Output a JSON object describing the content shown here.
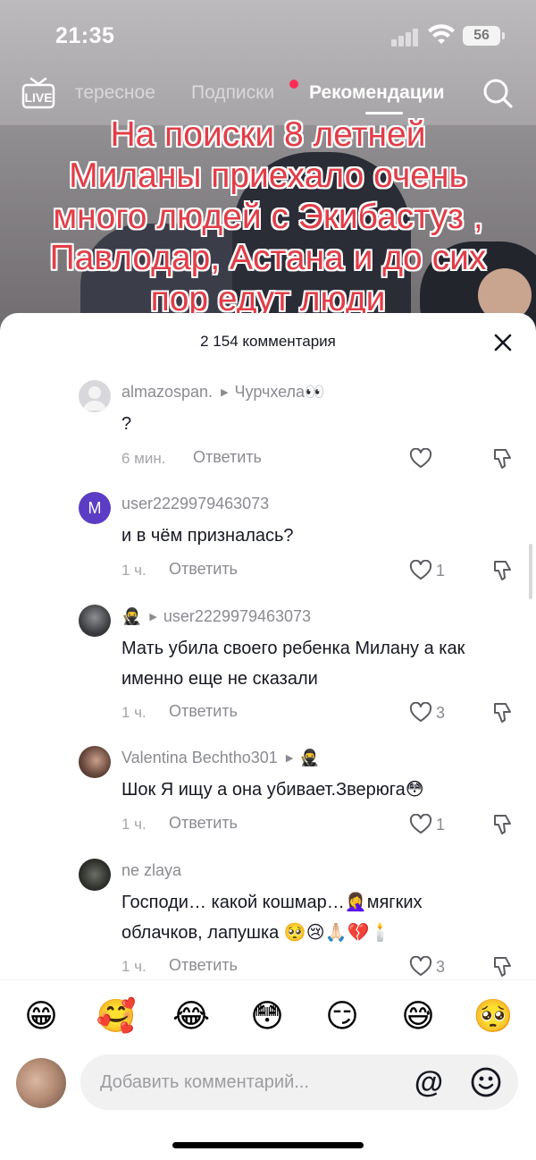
{
  "status_bar": {
    "time": "21:35",
    "battery": "56"
  },
  "top_nav": {
    "live_label": "LIVE",
    "tabs": [
      {
        "label": "тересное"
      },
      {
        "label": "Подписки"
      },
      {
        "label": "Рекомендации"
      }
    ]
  },
  "video": {
    "caption": "На поиски 8 летней\nМиланы приехало очень\nмного людей с Экибастуз ,\nПавлодар, Астана и до сих\nпор едут люди"
  },
  "comments_sheet": {
    "count_label": "2 154 комментария",
    "reply_label": "Ответить",
    "comments": [
      {
        "username": "almazospan.",
        "reply_to": "Чурчхела👀",
        "text": "?",
        "time": "6 мин.",
        "likes": ""
      },
      {
        "username": "user2229979463073",
        "reply_to": "",
        "text": "и в чём призналась?",
        "time": "1 ч.",
        "likes": "1"
      },
      {
        "username": "🥷",
        "reply_to": "user2229979463073",
        "text": "Мать убила своего ребенка Милану а как именно еще не сказали",
        "time": "1 ч.",
        "likes": "3"
      },
      {
        "username": "Valentina Bechtho301",
        "reply_to": "🥷",
        "text": "Шок Я ищу а она убивает.Зверюга😳",
        "time": "1 ч.",
        "likes": "1"
      },
      {
        "username": "ne zlaya",
        "reply_to": "",
        "text": "Господи… какой кошмар…🤦‍♀️мягких облачков, лапушка 🥺😢🙏🏻💔🕯️",
        "time": "1 ч.",
        "likes": "3"
      }
    ]
  },
  "emoji_bar": [
    "😁",
    "🥰",
    "😂",
    "😳",
    "😏",
    "😅",
    "🥺"
  ],
  "comment_input": {
    "placeholder": "Добавить комментарий...",
    "mention_symbol": "@"
  },
  "colors": {
    "accent_dot": "#fe2c55",
    "caption": "#e13d47",
    "text": "#161823",
    "muted": "#8a8b91"
  }
}
